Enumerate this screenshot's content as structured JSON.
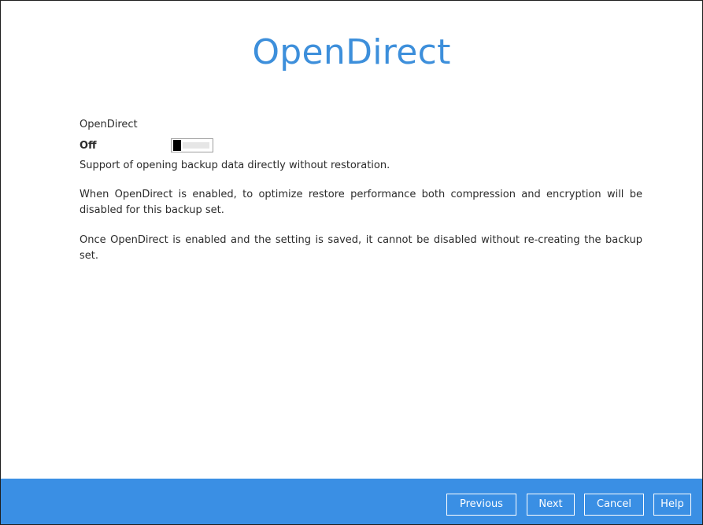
{
  "header": {
    "title": "OpenDirect"
  },
  "opendirect": {
    "section_label": "OpenDirect",
    "toggle_state": "Off",
    "toggle_on": false,
    "description": "Support of opening backup data directly without restoration.",
    "note_compression": "When OpenDirect is enabled, to optimize restore performance both compression and encryption will be disabled for this backup set.",
    "note_permanent": "Once OpenDirect is enabled and the setting is saved, it cannot be disabled without re-creating the backup set."
  },
  "footer": {
    "previous_label": "Previous",
    "next_label": "Next",
    "cancel_label": "Cancel",
    "help_label": "Help"
  },
  "colors": {
    "title": "#3d8fdb",
    "footer_bg": "#3a8fe4",
    "button_text": "#ffffff"
  }
}
